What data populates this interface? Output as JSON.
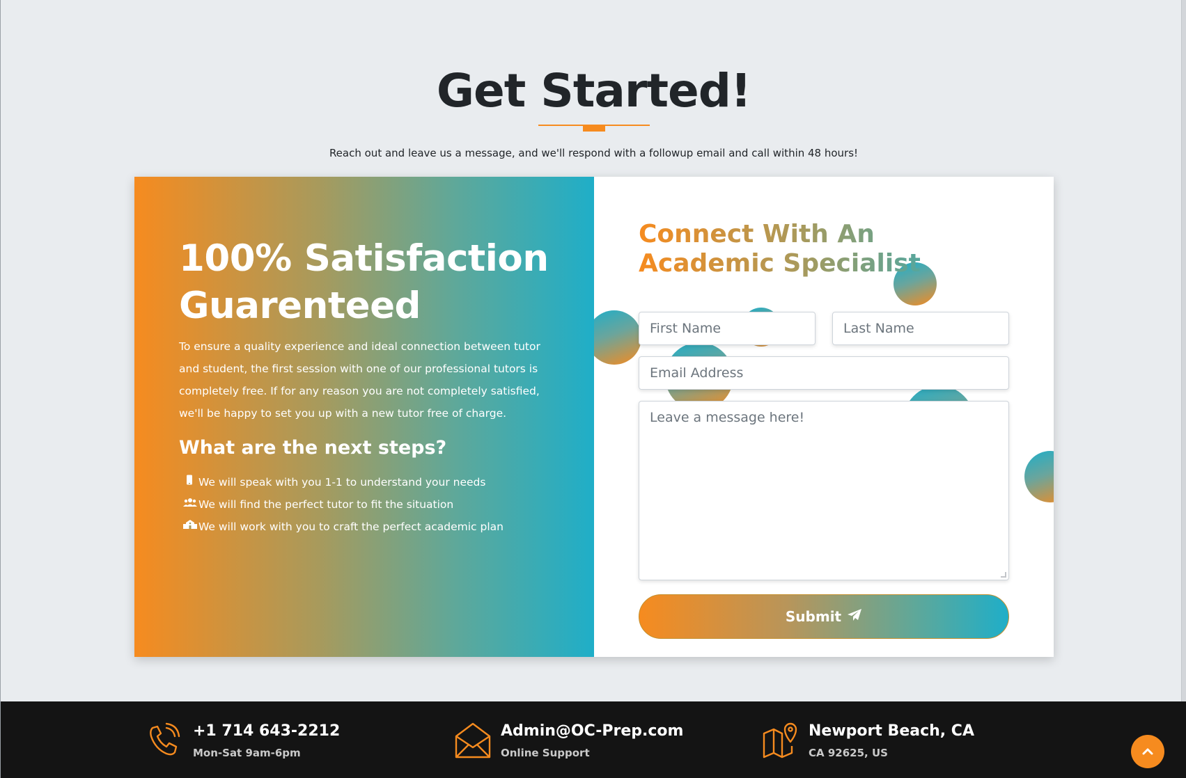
{
  "section": {
    "title": "Get Started!",
    "subtitle": "Reach out and leave us a message, and we'll respond with a followup email and call within 48 hours!"
  },
  "left": {
    "heading": "100% Satisfaction Guarenteed",
    "body": "To ensure a quality experience and ideal connection between tutor and student, the first session with one of our professional tutors is completely free. If for any reason you are not completely satisfied, we'll be happy to set you up with a new tutor free of charge.",
    "steps_heading": "What are the next steps?",
    "steps": [
      {
        "icon": "mobile-phone-icon",
        "text": "We will speak with you 1-1 to understand your needs"
      },
      {
        "icon": "users-icon",
        "text": "We will find the perfect tutor to fit the situation"
      },
      {
        "icon": "school-icon",
        "text": "We will work with you to craft the perfect academic plan"
      }
    ]
  },
  "form": {
    "heading": "Connect With An Academic Specialist",
    "first_name_placeholder": "First Name",
    "last_name_placeholder": "Last Name",
    "email_placeholder": "Email Address",
    "message_placeholder": "Leave a message here!",
    "submit_label": "Submit"
  },
  "footer": {
    "phone": {
      "main": "+1 714 643-2212",
      "sub": "Mon-Sat 9am-6pm",
      "icon": "phone-icon"
    },
    "email": {
      "main": "Admin@OC-Prep.com",
      "sub": "Online Support",
      "icon": "envelope-icon"
    },
    "location": {
      "main": "Newport Beach, CA",
      "sub": "CA 92625, US",
      "icon": "map-pin-icon"
    }
  },
  "colors": {
    "accent_orange": "#f68b1f",
    "accent_teal": "#1faec8",
    "title_text": "#212529",
    "footer_bg": "#141414",
    "page_bg": "#e9ecef"
  }
}
